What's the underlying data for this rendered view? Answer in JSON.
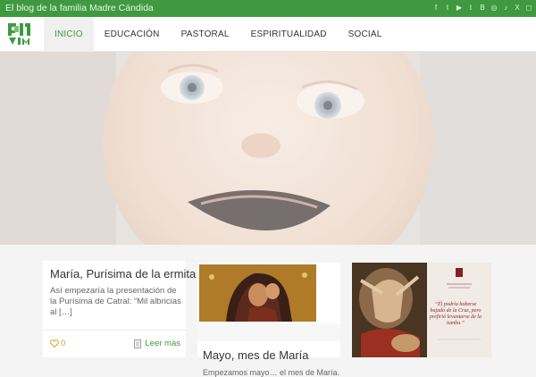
{
  "topbar": {
    "site_title": "El blog de la familia Madre Cándida",
    "social_icons": [
      {
        "name": "facebook-icon",
        "glyph": "f"
      },
      {
        "name": "twitter-icon",
        "glyph": "t"
      },
      {
        "name": "youtube-icon",
        "glyph": "▶"
      },
      {
        "name": "tumblr-icon",
        "glyph": "t"
      },
      {
        "name": "blogger-icon",
        "glyph": "B"
      },
      {
        "name": "flickr-icon",
        "glyph": "◎"
      },
      {
        "name": "tiktok-icon",
        "glyph": "♪"
      },
      {
        "name": "xing-icon",
        "glyph": "X"
      },
      {
        "name": "instagram-icon",
        "glyph": "◻"
      }
    ]
  },
  "nav": {
    "items": [
      {
        "label": "INICIO",
        "active": true
      },
      {
        "label": "EDUCACIÓN",
        "active": false
      },
      {
        "label": "PASTORAL",
        "active": false
      },
      {
        "label": "ESPIRITUALIDAD",
        "active": false
      },
      {
        "label": "SOCIAL",
        "active": false
      }
    ]
  },
  "posts": [
    {
      "title": "María, Purísima de la ermita",
      "excerpt": "Así empezaría la presentación de la Purísima de Catral: “Mil albricias al […]",
      "likes": "0",
      "read_more": "Leer más"
    },
    {
      "title": "Mayo, mes de María",
      "excerpt": "Empezamos mayo… el mes de María."
    },
    {
      "quote": "“Él podría haberse bajado de la Cruz, pero prefirió levantarse de la tumba.”"
    }
  ],
  "colors": {
    "brand_green": "#3f9a3f",
    "accent_gold": "#cfa52a"
  }
}
